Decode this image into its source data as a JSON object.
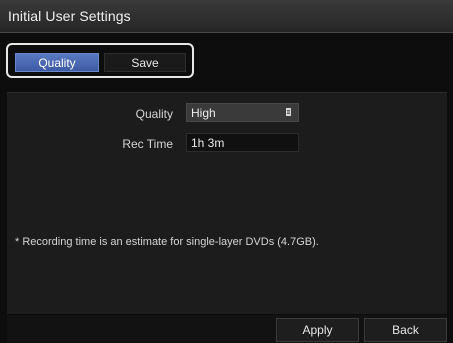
{
  "window": {
    "title": "Initial User Settings"
  },
  "tabs": [
    {
      "label": "Quality",
      "selected": true
    },
    {
      "label": "Save",
      "selected": false
    }
  ],
  "quality": {
    "label": "Quality",
    "value": "High",
    "icon": "dropdown-list-icon"
  },
  "rec_time": {
    "label": "Rec Time",
    "value": "1h 3m"
  },
  "note": "* Recording time is an estimate for single-layer DVDs (4.7GB).",
  "buttons": {
    "apply": "Apply",
    "back": "Back"
  },
  "colors": {
    "accent": "#4a68b2",
    "background": "#0d0d0d",
    "panel": "#1c1c1c",
    "text": "#e6e6e6"
  }
}
